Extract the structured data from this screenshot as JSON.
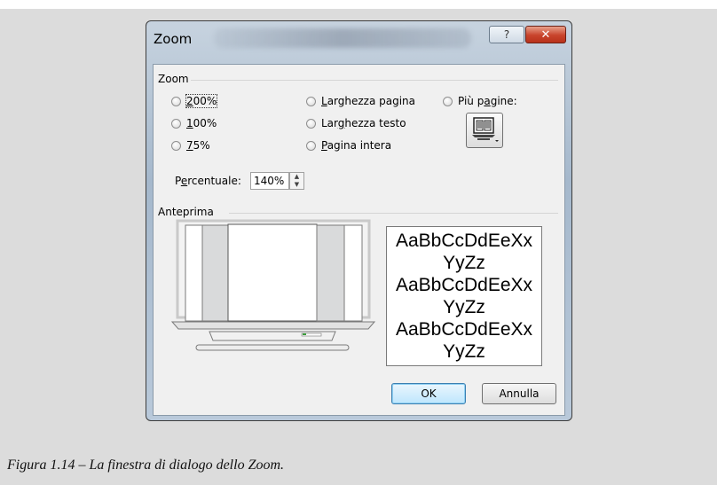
{
  "window": {
    "title": "Zoom",
    "help_glyph": "?",
    "close_glyph": "✕"
  },
  "zoom_group": {
    "label": "Zoom",
    "options": {
      "p200": "200%",
      "p100": "100%",
      "p75": "75%",
      "page_width": "Larghezza pagina",
      "text_width": "Larghezza testo",
      "whole_page": "Pagina intera",
      "many_pages": "Più pagine:"
    },
    "percent_label": "Percentuale:",
    "percent_value": "140%"
  },
  "preview_group": {
    "label": "Anteprima",
    "sample_lines": [
      "AaBbCcDdEeXx",
      "YyZz",
      "AaBbCcDdEeXx",
      "YyZz",
      "AaBbCcDdEeXx",
      "YyZz"
    ]
  },
  "buttons": {
    "ok": "OK",
    "cancel": "Annulla"
  },
  "caption": "Figura 1.14 – La finestra di dialogo dello Zoom.",
  "icons": {
    "help": "question-icon",
    "close": "close-icon",
    "many_pages": "multiple-pages-monitor-icon",
    "spin_up": "triangle-up-icon",
    "spin_down": "triangle-down-icon"
  }
}
